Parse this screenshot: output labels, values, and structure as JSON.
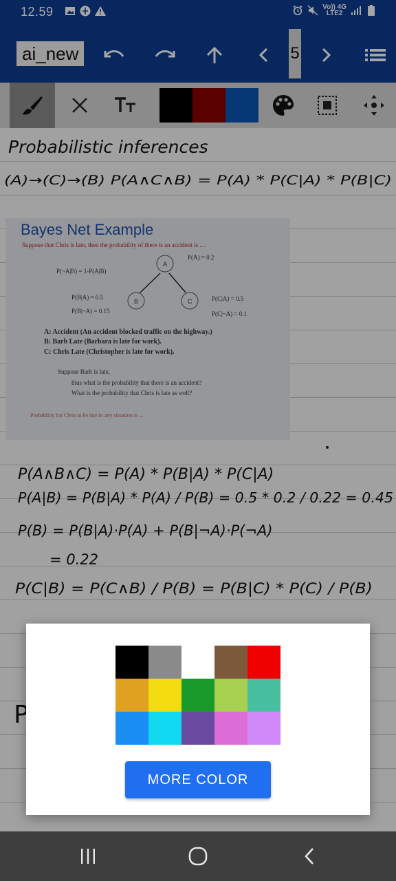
{
  "status_bar": {
    "time": "12.59",
    "net_top": "Vo)) 4G",
    "net_bottom": "LTE2"
  },
  "toolbar": {
    "doc_name": "ai_new",
    "page_number": "5"
  },
  "tools": {
    "pen_colors": [
      "#000000",
      "#8b0000",
      "#0b56b5"
    ]
  },
  "canvas": {
    "handwriting": [
      "Probabilistic inferences",
      "(A)→(C)→(B)   P(A∧C∧B) = P(A) * P(C|A) * P(B|C)",
      "P(A∧B∧C) = P(A) * P(B|A) * P(C|A)",
      "P(A|B) = P(B|A) * P(A) / P(B) = 0.5 * 0.2 / 0.22 = 0.45",
      "P(B) = P(B|A)·P(A) + P(B|¬A)·P(¬A)",
      "= 0.22",
      "P(C|B) = P(C∧B) / P(B) = P(B|C) * P(C) / P(B)",
      "P"
    ],
    "photo": {
      "title": "Bayes Net Example",
      "intro": "Suppose that Chris is late, then the probability of there is an accident is ....",
      "pa": "P(A) = 0.2",
      "pnab": "P(~A|B) = 1-P(A|B)",
      "pba": "P(B|A) = 0.5",
      "pbna": "P(B|~A) = 0.15",
      "pca": "P(C|A) = 0.5",
      "pcna": "P(C|~A) = 0.1",
      "node_a": "A",
      "node_b": "B",
      "node_c": "C",
      "def_a": "A: Accident (An accident blocked traffic on the highway.)",
      "def_b": "B: Barb Late (Barbara is late for work).",
      "def_c": "C: Chris Late (Christopher is late for work).",
      "q1": "Suppose Barb is late,",
      "q2": "thus what is the probability that there is an accident?",
      "q3": "What is the probability that Chris is late as well?",
      "foot": "Probability for Chris to be late in any situation is ..."
    }
  },
  "color_dialog": {
    "colors": [
      "#000000",
      "#8a8a8a",
      "#ffffff",
      "#7a5a3a",
      "#ee0000",
      "#e0a020",
      "#f2dc10",
      "#1a9a2a",
      "#a8d050",
      "#48c0a0",
      "#1a8ef2",
      "#10d8f0",
      "#6a4aa0",
      "#dc6cd8",
      "#d088f8"
    ],
    "more_button": "MORE COLOR"
  }
}
